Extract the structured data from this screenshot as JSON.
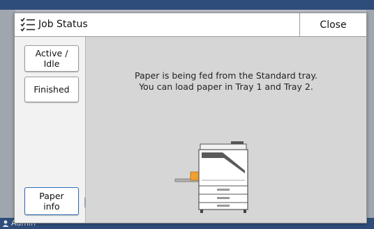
{
  "background": {
    "user_label": "Admin"
  },
  "dialog": {
    "title": "Job Status",
    "close_label": "Close"
  },
  "sidebar": {
    "active_idle_label": "Active /\nIdle",
    "finished_label": "Finished",
    "paper_info_label": "Paper\ninfo"
  },
  "content": {
    "message_line1": "Paper is being fed from the Standard tray.",
    "message_line2": "You can load paper in Tray 1 and Tray 2."
  },
  "colors": {
    "accent": "#2f6db5",
    "tray_paper": "#f0a030"
  }
}
